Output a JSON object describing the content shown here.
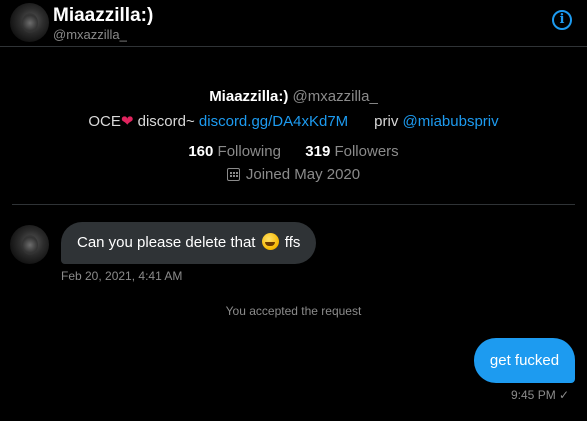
{
  "header": {
    "name": "Miaazzilla:)",
    "handle": "@mxazzilla_",
    "info_icon": "info-icon"
  },
  "profile": {
    "name": "Miaazzilla:)",
    "handle": "@mxazzilla_",
    "bio_prefix": "OCE",
    "bio_heart": "❤",
    "bio_discord_label": " discord~ ",
    "bio_discord_link": "discord.gg/DA4xKd7M",
    "bio_priv_label": "priv ",
    "bio_priv_link": "@miabubspriv",
    "following_count": "160",
    "following_label": "Following",
    "followers_count": "319",
    "followers_label": "Followers",
    "joined": "Joined May 2020"
  },
  "messages": {
    "incoming_text_before": "Can you please delete that ",
    "incoming_emoji": "rolling-on-floor-laughing",
    "incoming_text_after": " ffs",
    "incoming_time": "Feb 20, 2021, 4:41 AM",
    "system_text": "You accepted the request",
    "outgoing_text": "get fucked",
    "outgoing_time": "9:45 PM",
    "outgoing_status": "✓"
  },
  "colors": {
    "background": "#000000",
    "accent": "#1d9bf0",
    "incoming_bubble": "#2f3336",
    "heart": "#e0245e"
  }
}
